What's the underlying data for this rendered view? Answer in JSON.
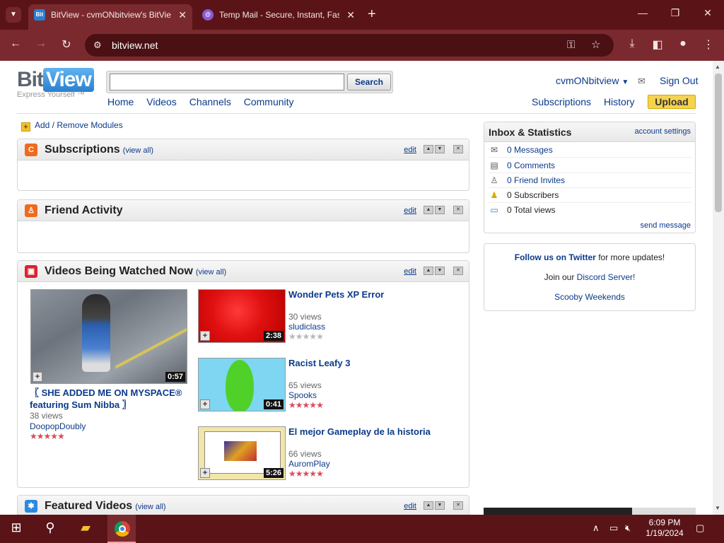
{
  "browser": {
    "tabs": [
      {
        "title": "BitView - cvmONbitview's BitView",
        "favicon": "Bit",
        "active": true
      },
      {
        "title": "Temp Mail - Secure, Instant, Fast",
        "favicon": "@",
        "active": false
      }
    ],
    "url": "bitview.net"
  },
  "site": {
    "logo_left": "Bit",
    "logo_right": "View",
    "tagline": "Express Yourself ™",
    "search": {
      "value": "",
      "placeholder": "",
      "button": "Search"
    },
    "nav": [
      "Home",
      "Videos",
      "Channels",
      "Community"
    ],
    "user": "cvmONbitview",
    "sign_out": "Sign Out",
    "subnav": [
      "Subscriptions",
      "History"
    ],
    "upload": "Upload",
    "add_modules": "Add / Remove Modules",
    "edit_label": "edit",
    "view_all": "(view all)"
  },
  "modules": {
    "subscriptions": {
      "title": "Subscriptions"
    },
    "friends": {
      "title": "Friend Activity"
    },
    "watched": {
      "title": "Videos Being Watched Now",
      "featured": {
        "title": "〖 SHE ADDED ME ON MYSPACE® featuring Sum Nibba 〗",
        "views": "38 views",
        "user": "DoopopDoubly",
        "duration": "0:57",
        "rating": 5
      },
      "videos": [
        {
          "title": "Wonder Pets XP Error",
          "views": "30 views",
          "user": "sludiclass",
          "duration": "2:38",
          "rating": 0
        },
        {
          "title": "Racist Leafy 3",
          "views": "65 views",
          "user": "Spooks",
          "duration": "0:41",
          "rating": 4.5
        },
        {
          "title": "El mejor Gameplay de la historia",
          "views": "66 views",
          "user": "AuromPlay",
          "duration": "5:26",
          "rating": 4.5
        }
      ]
    },
    "featured": {
      "title": "Featured Videos"
    }
  },
  "inbox": {
    "title": "Inbox & Statistics",
    "settings": "account settings",
    "rows": [
      "0 Messages",
      "0 Comments",
      "0 Friend Invites",
      "0 Subscribers",
      "0 Total views"
    ],
    "send": "send message"
  },
  "follow": {
    "twitter_link": "Follow us on Twitter",
    "twitter_rest": " for more updates!",
    "discord_pre": "Join our ",
    "discord_link": "Discord Server!",
    "scooby": "Scooby Weekends"
  },
  "taskbar": {
    "time": "6:09 PM",
    "date": "1/19/2024"
  },
  "colors": {
    "accent": "#0b3a8a",
    "upload": "#f5d34f",
    "chrome": "#7a2a2e"
  }
}
